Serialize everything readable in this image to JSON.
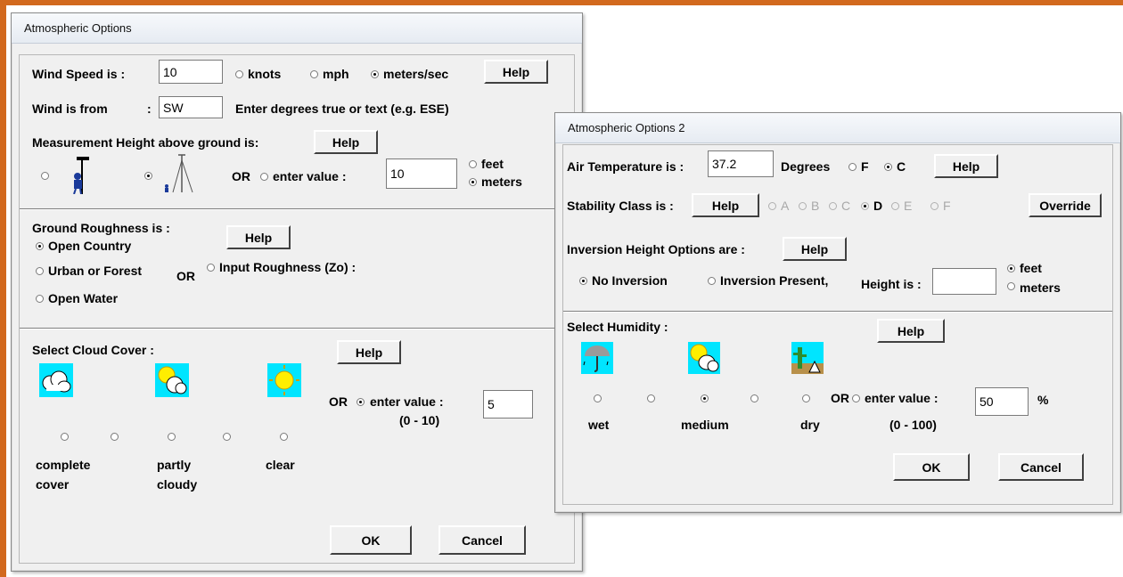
{
  "dialog1": {
    "title": "Atmospheric Options",
    "wind_speed": {
      "label": "Wind Speed is :",
      "value": "10",
      "unit_options": [
        "knots",
        "mph",
        "meters/sec"
      ],
      "selected_unit": "meters/sec",
      "help": "Help"
    },
    "wind_from": {
      "label": "Wind is from",
      "colon": ":",
      "value": "SW",
      "hint": "Enter degrees true or text (e.g. ESE)"
    },
    "measurement_height": {
      "label": "Measurement Height above ground is:",
      "help": "Help",
      "or": "OR",
      "enter_value_label": "enter value :",
      "value": "10",
      "units": [
        "feet",
        "meters"
      ],
      "selected_unit": "meters",
      "icons": [
        "person-weather-vane-icon",
        "tower-icon"
      ]
    },
    "ground_roughness": {
      "label": "Ground Roughness is :",
      "help": "Help",
      "options": [
        "Open Country",
        "Urban or Forest",
        "Open Water"
      ],
      "selected": "Open Country",
      "or": "OR",
      "input_label": "Input Roughness (Zo) :"
    },
    "cloud_cover": {
      "label": "Select Cloud Cover :",
      "help": "Help",
      "or": "OR",
      "enter_value_label": "enter value :",
      "range": "(0 - 10)",
      "value": "5",
      "labels": [
        {
          "line1": "complete",
          "line2": "cover"
        },
        {
          "line1": "partly",
          "line2": "cloudy"
        },
        {
          "line1": "clear",
          "line2": ""
        }
      ],
      "icons": [
        "cloud-icon",
        "sun-cloud-icon",
        "sun-icon"
      ]
    },
    "ok": "OK",
    "cancel": "Cancel"
  },
  "dialog2": {
    "title": "Atmospheric Options 2",
    "air_temp": {
      "label": "Air Temperature is :",
      "value": "37.2",
      "degrees": "Degrees",
      "options": [
        "F",
        "C"
      ],
      "selected": "C",
      "help": "Help"
    },
    "stability": {
      "label": "Stability Class is :",
      "help": "Help",
      "classes": [
        "A",
        "B",
        "C",
        "D",
        "E",
        "F"
      ],
      "selected": "D",
      "override": "Override"
    },
    "inversion": {
      "label": "Inversion Height Options are :",
      "help": "Help",
      "no_inversion": "No Inversion",
      "present": "Inversion Present,",
      "height_is": "Height is :",
      "value": "",
      "units": [
        "feet",
        "meters"
      ],
      "selected_unit": "feet"
    },
    "humidity": {
      "label": "Select Humidity :",
      "help": "Help",
      "labels": [
        "wet",
        "medium",
        "dry"
      ],
      "or": "OR",
      "enter_value_label": "enter value :",
      "range": "(0 - 100)",
      "value": "50",
      "percent": "%",
      "icons": [
        "umbrella-rain-icon",
        "sun-cloud-icon",
        "cactus-desert-icon"
      ]
    },
    "ok": "OK",
    "cancel": "Cancel"
  },
  "colors": {
    "frame": "#d2691e",
    "dialog_bg": "#f0f0f0",
    "icon_bg": "#00e5ff",
    "sun": "#ffee00"
  }
}
